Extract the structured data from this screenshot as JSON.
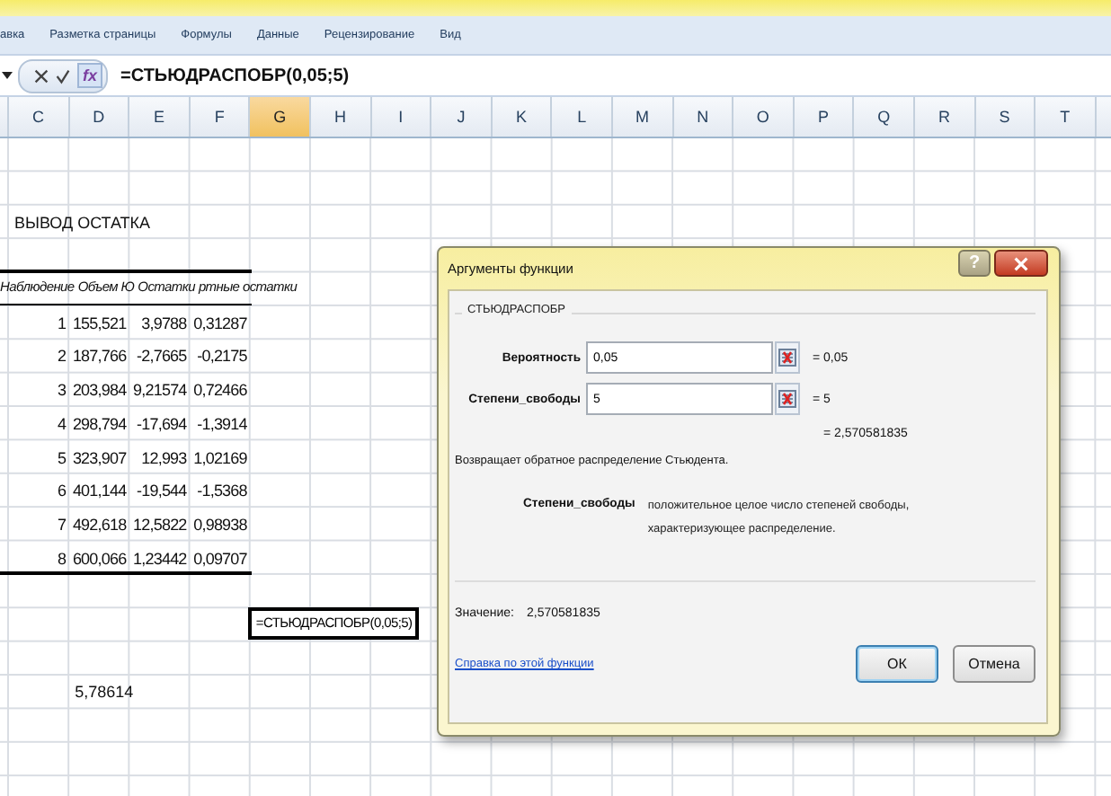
{
  "ribbon": {
    "tabs": [
      {
        "label": "авка",
        "selected": false
      },
      {
        "label": "Разметка страницы",
        "selected": false
      },
      {
        "label": "Формулы",
        "selected": false
      },
      {
        "label": "Данные",
        "selected": false
      },
      {
        "label": "Рецензирование",
        "selected": false
      },
      {
        "label": "Вид",
        "selected": false
      }
    ]
  },
  "formula_bar": {
    "function_button": "fx",
    "formula": "=СТЬЮДРАСПОБР(0,05;5)"
  },
  "sheet": {
    "columns": [
      {
        "label": "C",
        "selected": false
      },
      {
        "label": "D",
        "selected": false
      },
      {
        "label": "E",
        "selected": false
      },
      {
        "label": "F",
        "selected": false
      },
      {
        "label": "G",
        "selected": true
      },
      {
        "label": "H",
        "selected": false
      },
      {
        "label": "I",
        "selected": false
      },
      {
        "label": "J",
        "selected": false
      },
      {
        "label": "K",
        "selected": false
      },
      {
        "label": "L",
        "selected": false
      },
      {
        "label": "M",
        "selected": false
      },
      {
        "label": "N",
        "selected": false
      },
      {
        "label": "O",
        "selected": false
      },
      {
        "label": "P",
        "selected": false
      },
      {
        "label": "Q",
        "selected": false
      },
      {
        "label": "R",
        "selected": false
      },
      {
        "label": "S",
        "selected": false
      },
      {
        "label": "T",
        "selected": false
      }
    ],
    "output_title": "ВЫВОД ОСТАТКА",
    "residual_table": {
      "columns": [
        "Наблюдение",
        "Объем Ю",
        "Остатки",
        "ртные остатки"
      ],
      "rows": [
        [
          "1",
          "155,521",
          "3,9788",
          "0,31287"
        ],
        [
          "2",
          "187,766",
          "-2,7665",
          "-0,2175"
        ],
        [
          "3",
          "203,984",
          "9,21574",
          "0,72466"
        ],
        [
          "4",
          "298,794",
          "-17,694",
          "-1,3914"
        ],
        [
          "5",
          "323,907",
          "12,993",
          "1,02169"
        ],
        [
          "6",
          "401,144",
          "-19,544",
          "-1,5368"
        ],
        [
          "7",
          "492,618",
          "12,5822",
          "0,98938"
        ],
        [
          "8",
          "600,066",
          "1,23442",
          "0,09707"
        ]
      ]
    },
    "formula_cell": {
      "text": "=СТЬЮДРАСПОБР(0,05;5)",
      "selected": true
    },
    "value_cell": "5,78614"
  },
  "dialog": {
    "title": "Аргументы функции",
    "help_button": "?",
    "function_name": "СТЬЮДРАСПОБР",
    "arguments": [
      {
        "label": "Вероятность",
        "value": "0,05",
        "result": "= 0,05"
      },
      {
        "label": "Степени_свободы",
        "value": "5",
        "result": "= 5"
      }
    ],
    "formula_result": "= 2,570581835",
    "description": "Возвращает обратное распределение Стьюдента.",
    "argument_help": {
      "label": "Степени_свободы",
      "text": "положительное целое число степеней свободы, характеризующее распределение."
    },
    "value_label": "Значение:",
    "value": "2,570581835",
    "help_link": "Справка по этой функции",
    "buttons": [
      {
        "label": "ОК",
        "focused": true
      },
      {
        "label": "Отмена",
        "focused": false
      }
    ]
  }
}
